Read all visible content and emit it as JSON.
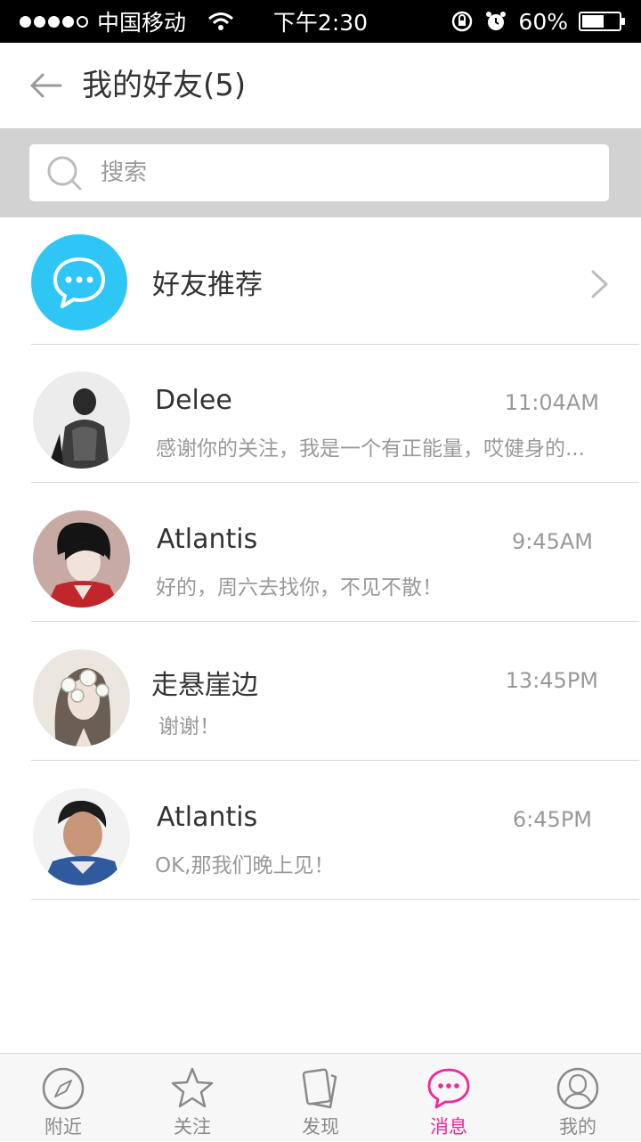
{
  "status_bar": {
    "carrier": "中国移动",
    "time": "下午2:30",
    "battery_text": "60%",
    "battery_level": 0.6
  },
  "header": {
    "back_icon": "back-arrow-icon",
    "title": "我的好友(5)"
  },
  "search": {
    "placeholder": "搜索",
    "icon": "search-icon"
  },
  "recommend": {
    "label": "好友推荐",
    "icon": "chat-bubble-icon",
    "color": "#2fc6f6"
  },
  "friends": [
    {
      "name": "Delee",
      "message": "感谢你的关注，我是一个有正能量，哎健身的...",
      "time": "11:04AM"
    },
    {
      "name": "Atlantis",
      "message": "好的，周六去找你，不见不散！",
      "time": "9:45AM"
    },
    {
      "name": "走悬崖边",
      "message": "谢谢！",
      "time": "13:45PM"
    },
    {
      "name": "Atlantis",
      "message": "OK,那我们晚上见！",
      "time": "6:45PM"
    }
  ],
  "tabbar": {
    "active_color": "#f0299a",
    "tabs": [
      {
        "label": "附近",
        "icon": "compass-icon"
      },
      {
        "label": "关注",
        "icon": "star-icon"
      },
      {
        "label": "发现",
        "icon": "cards-icon"
      },
      {
        "label": "消息",
        "icon": "message-icon",
        "active": true
      },
      {
        "label": "我的",
        "icon": "profile-icon"
      }
    ]
  }
}
